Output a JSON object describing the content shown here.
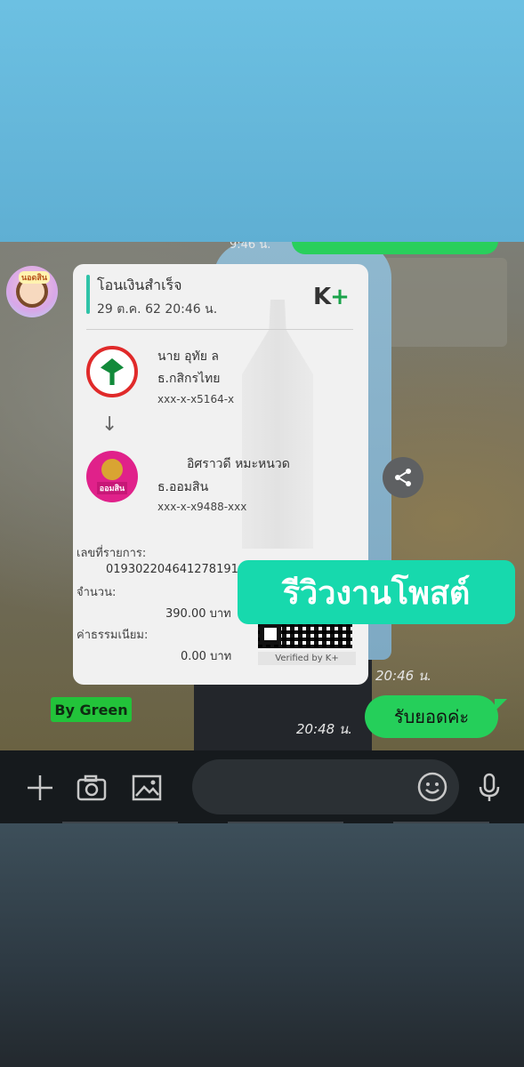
{
  "chat": {
    "prev_message_time": "9:46 น.",
    "sender_avatar": {
      "label": "นอดสิน"
    },
    "slip": {
      "title": "โอนเงินสำเร็จ",
      "datetime": "29 ต.ค. 62  20:46 น.",
      "brand_logo": {
        "k": "K",
        "plus": "+"
      },
      "sender": {
        "name": "นาย อุทัย ล",
        "bank": "ธ.กสิกรไทย",
        "account": "xxx-x-x5164-x"
      },
      "receiver": {
        "name": "อิศราวดี หมะหนวด",
        "bank": "ธ.ออมสิน",
        "account": "xxx-x-x9488-xxx",
        "logo_text": "ออมสิน"
      },
      "ref_label": "เลขที่รายการ:",
      "ref_value": "019302204641278191",
      "amount_label": "จำนวน:",
      "amount_value": "390.00 บาท",
      "fee_label": "ค่าธรรมเนียม:",
      "fee_value": "0.00 บาท",
      "verified_text": "Verified by K+"
    },
    "review_badge": "รีวิวงานโพสต์",
    "slip_time": "20:46 น.",
    "watermark": "By Green",
    "reply": {
      "text": "รับยอดค่ะ",
      "time": "20:48 น."
    }
  },
  "input_bar": {
    "icons": [
      "plus-icon",
      "camera-icon",
      "image-icon",
      "emoji-icon",
      "microphone-icon"
    ],
    "message_value": ""
  },
  "colors": {
    "accent_green": "#25cf5a",
    "review_badge": "#17d9ad",
    "kbank_red": "#e02a2a",
    "gsb_pink": "#e0218a"
  }
}
